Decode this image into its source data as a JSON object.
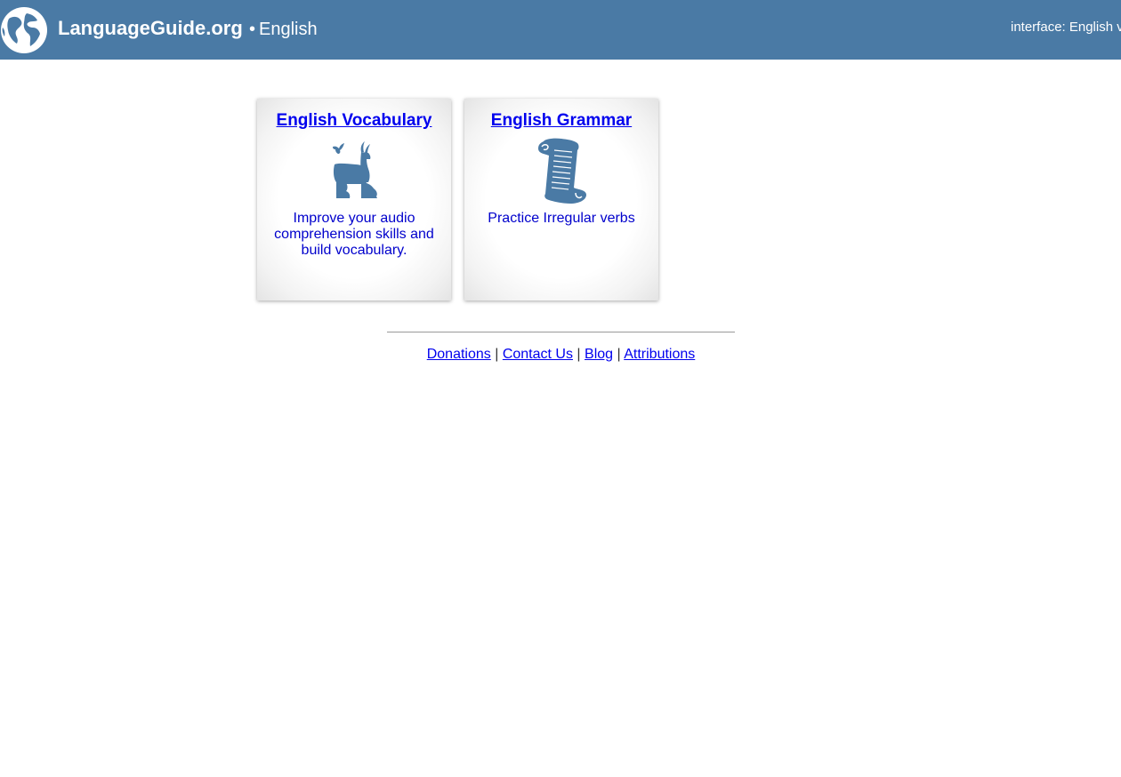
{
  "header": {
    "site_title": "LanguageGuide.org",
    "dot": "•",
    "language": "English",
    "interface_label": "interface: English",
    "interface_arrow": "v",
    "logo_icon": "globe-icon",
    "background": "#4a7aa5"
  },
  "cards": [
    {
      "title": "English Vocabulary",
      "description": "Improve your audio comprehension skills and build vocabulary.",
      "icon": "animals-icon"
    },
    {
      "title": "English Grammar",
      "description": "Practice Irregular verbs",
      "icon": "scroll-icon"
    }
  ],
  "footer": {
    "links": [
      "Donations",
      "Contact Us",
      "Blog",
      "Attributions"
    ],
    "separator": "|"
  },
  "colors": {
    "link": "#0000ee",
    "icon": "#4a7aa5"
  }
}
